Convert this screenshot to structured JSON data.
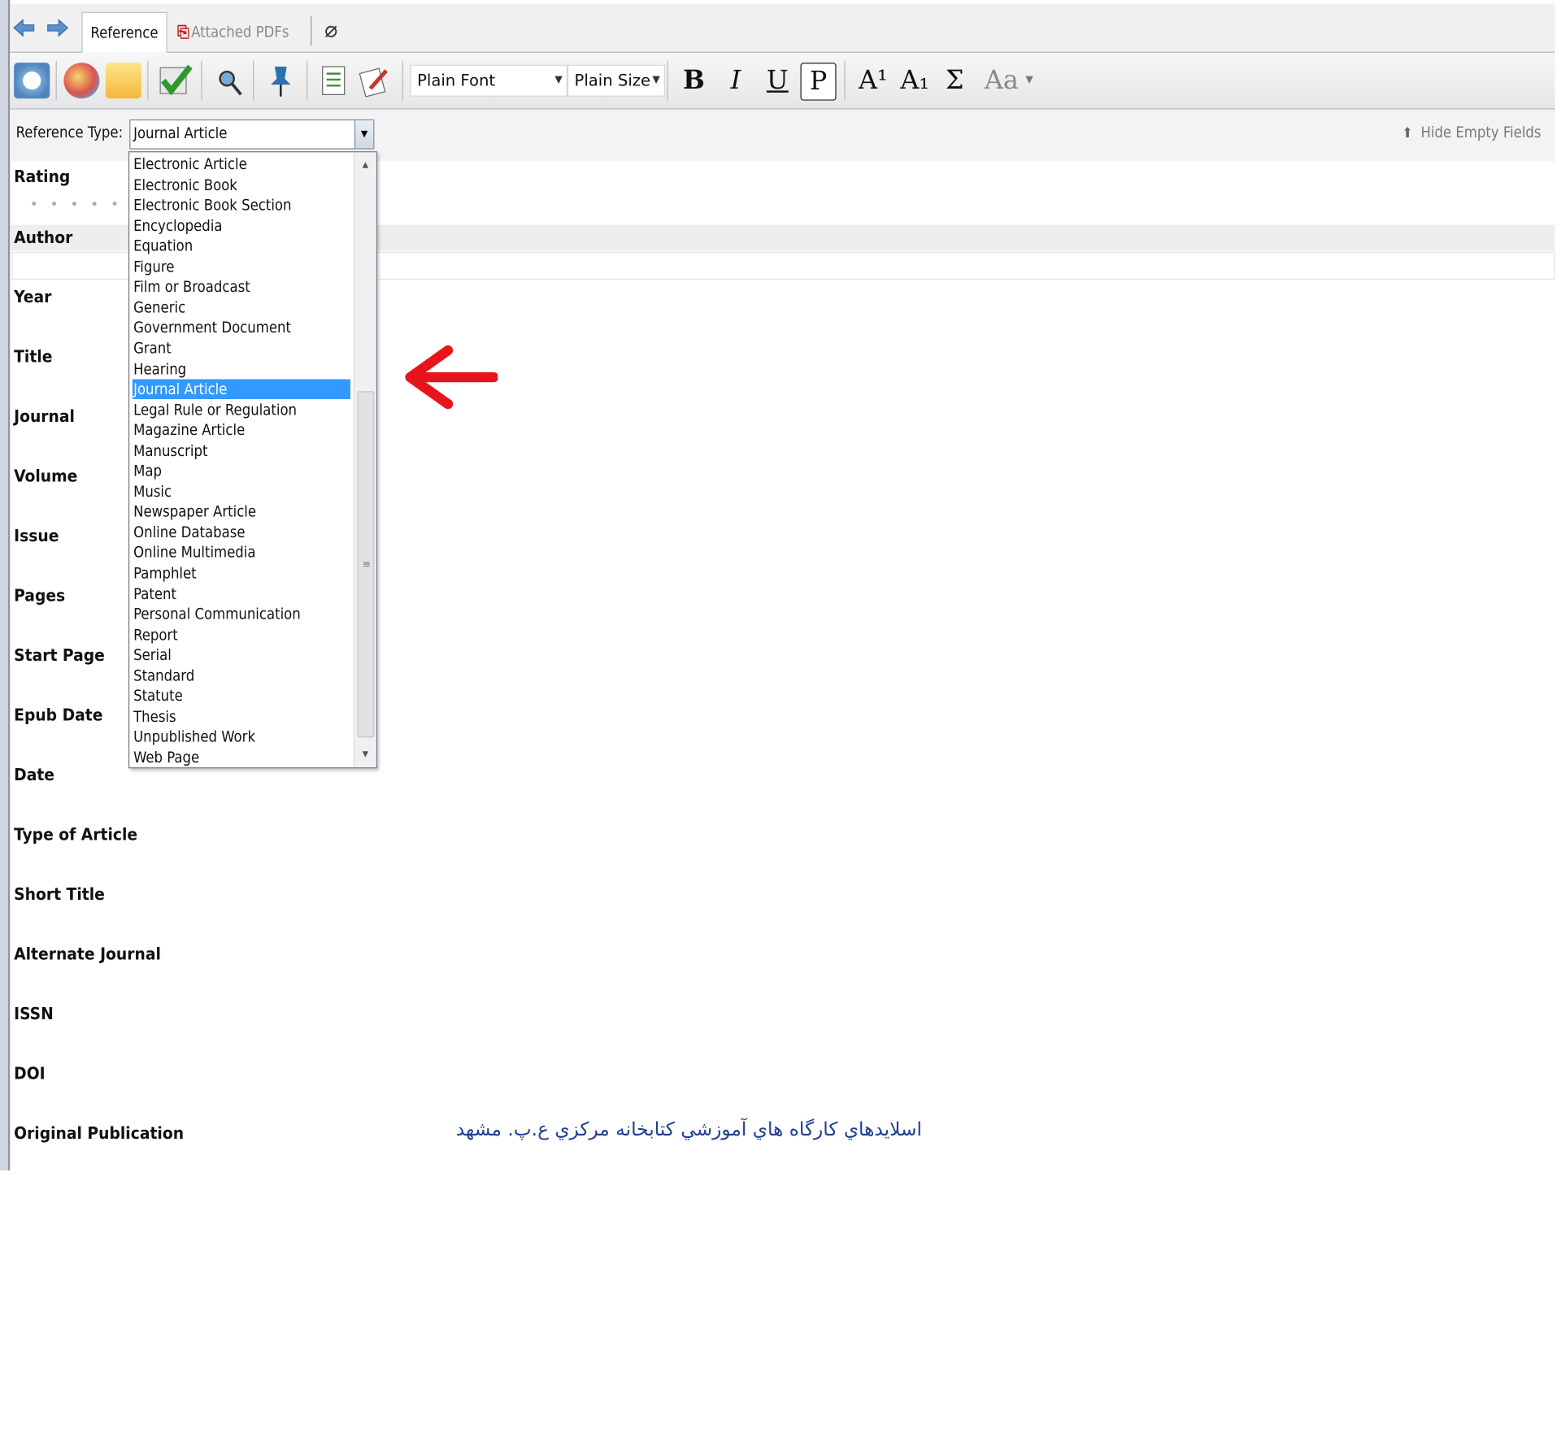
{
  "tabs": {
    "reference": "Reference",
    "attached_pdfs": "Attached PDFs"
  },
  "toolbar": {
    "font_value": "Plain Font",
    "size_value": "Plain Size",
    "bold": "B",
    "italic": "I",
    "underline": "U",
    "plain": "P",
    "superscript": "A¹",
    "subscript": "A₁",
    "symbol": "Σ",
    "case": "Aa"
  },
  "reference_type": {
    "label": "Reference Type:",
    "value": "Journal Article",
    "hide_empty": "Hide Empty Fields"
  },
  "fields": {
    "rating": "Rating",
    "author": "Author",
    "year": "Year",
    "title": "Title",
    "journal": "Journal",
    "volume": "Volume",
    "issue": "Issue",
    "pages": "Pages",
    "start_page": "Start Page",
    "epub_date": "Epub Date",
    "date": "Date",
    "type_of_article": "Type of Article",
    "short_title": "Short Title",
    "alternate_journal": "Alternate Journal",
    "issn": "ISSN",
    "doi": "DOI",
    "original_publication": "Original Publication"
  },
  "dropdown": {
    "items": [
      "Electronic Article",
      "Electronic Book",
      "Electronic Book Section",
      "Encyclopedia",
      "Equation",
      "Figure",
      "Film or Broadcast",
      "Generic",
      "Government Document",
      "Grant",
      "Hearing",
      "Journal Article",
      "Legal Rule or Regulation",
      "Magazine Article",
      "Manuscript",
      "Map",
      "Music",
      "Newspaper Article",
      "Online Database",
      "Online Multimedia",
      "Pamphlet",
      "Patent",
      "Personal Communication",
      "Report",
      "Serial",
      "Standard",
      "Statute",
      "Thesis",
      "Unpublished Work",
      "Web Page"
    ],
    "selected": "Journal Article"
  },
  "footer": "اسلايدهاي كارگاه هاي آموزشي كتابخانه مركزي ع.پ. مشهد",
  "colors": {
    "selection": "#3399ff",
    "arrow": "#e8141b",
    "footer_text": "#1f3f8f"
  }
}
